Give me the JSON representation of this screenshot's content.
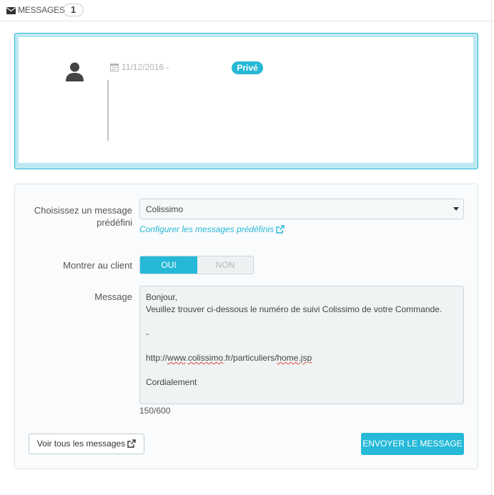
{
  "header": {
    "icon": "envelope-icon",
    "title": "MESSAGES",
    "count": "1"
  },
  "thread": {
    "avatar_icon": "user-icon",
    "calendar_icon": "calendar-icon",
    "date": "11/12/2016 -",
    "badge": "Privé",
    "accent_color": "#25b9d7"
  },
  "form": {
    "predefined_label": "Choisissez un message prédéfini",
    "predefined_value": "Colissimo",
    "configure_link": "Configurer les messages prédéfinis",
    "show_client_label": "Montrer au client",
    "toggle_on": "OUI",
    "toggle_off": "NON",
    "toggle_selected": "OUI",
    "message_label": "Message",
    "message_lines": [
      "Bonjour,",
      "Veuillez trouver ci-dessous le numéro de suivi Colissimo de votre Commande.",
      "",
      "-",
      "",
      "http://www.colissimo.fr/particuliers/home.jsp",
      "",
      "Cordialement"
    ],
    "char_count": "150/600",
    "view_all_button": "Voir tous les messages",
    "send_button": "ENVOYER LE MESSAGE"
  }
}
